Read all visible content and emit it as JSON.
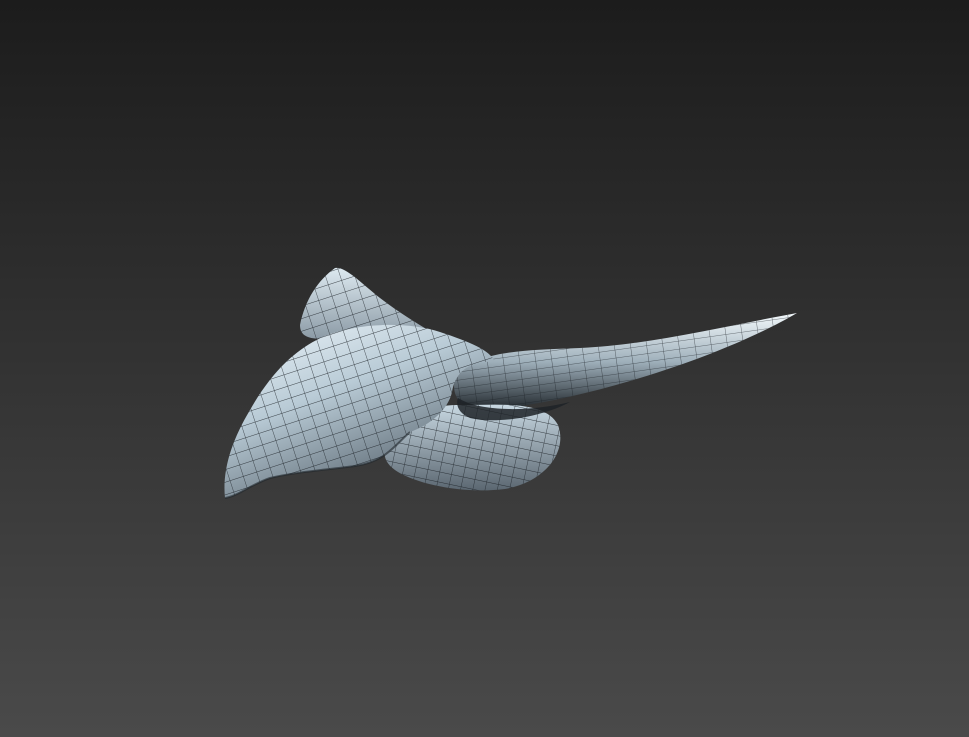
{
  "viewport": {
    "background": {
      "top_color": "#1c1c1c",
      "bottom_color": "#4a4a4a"
    },
    "model": {
      "name": "wireframe-mesh-model",
      "base_color": "#b9cbd6",
      "highlight_color": "#eef6fb",
      "shadow_color": "#2a3036",
      "wire_color": "#1a1f24"
    }
  }
}
